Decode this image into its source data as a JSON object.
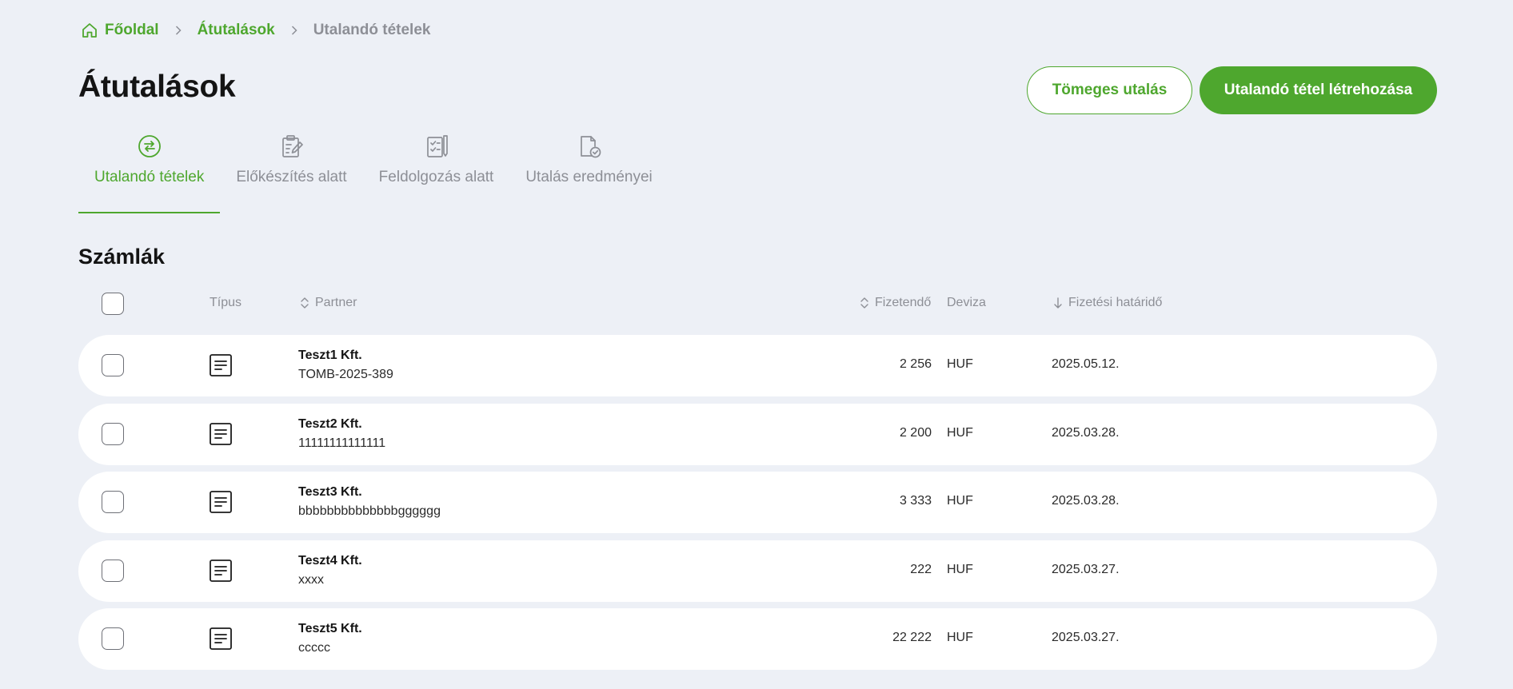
{
  "breadcrumb": {
    "items": [
      {
        "label": "Főoldal",
        "icon": "home-icon"
      },
      {
        "label": "Átutalások"
      },
      {
        "label": "Utalandó tételek"
      }
    ]
  },
  "page": {
    "title": "Átutalások"
  },
  "actions": {
    "bulk_label": "Tömeges utalás",
    "create_label": "Utalandó tétel létrehozása"
  },
  "tabs": [
    {
      "label": "Utalandó tételek",
      "icon": "transfer-icon",
      "active": true
    },
    {
      "label": "Előkészítés alatt",
      "icon": "clipboard-edit-icon",
      "active": false
    },
    {
      "label": "Feldolgozás alatt",
      "icon": "checklist-icon",
      "active": false
    },
    {
      "label": "Utalás eredményei",
      "icon": "document-check-icon",
      "active": false
    }
  ],
  "section": {
    "title": "Számlák"
  },
  "table": {
    "columns": {
      "type": "Típus",
      "partner": "Partner",
      "amount": "Fizetendő",
      "currency": "Deviza",
      "due": "Fizetési határidő"
    },
    "rows": [
      {
        "partner": "Teszt1 Kft.",
        "reference": "TOMB-2025-389",
        "amount": "2 256",
        "currency": "HUF",
        "due": "2025.05.12."
      },
      {
        "partner": "Teszt2 Kft.",
        "reference": "11111111111111",
        "amount": "2 200",
        "currency": "HUF",
        "due": "2025.03.28."
      },
      {
        "partner": "Teszt3 Kft.",
        "reference": "bbbbbbbbbbbbbbgggggg",
        "amount": "3 333",
        "currency": "HUF",
        "due": "2025.03.28."
      },
      {
        "partner": "Teszt4 Kft.",
        "reference": "xxxx",
        "amount": "222",
        "currency": "HUF",
        "due": "2025.03.27."
      },
      {
        "partner": "Teszt5 Kft.",
        "reference": "ccccc",
        "amount": "22 222",
        "currency": "HUF",
        "due": "2025.03.27."
      }
    ]
  },
  "colors": {
    "accent": "#4ea72e",
    "background": "#edf0f6",
    "muted": "#8d8f96"
  }
}
